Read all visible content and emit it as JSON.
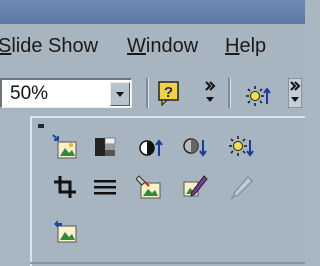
{
  "menu": {
    "items": [
      {
        "label": "Slide Show",
        "underline": "S"
      },
      {
        "label": "Window",
        "underline": "W"
      },
      {
        "label": "Help",
        "underline": "H"
      }
    ]
  },
  "toolbar": {
    "zoom_value": "50%"
  },
  "picture_toolbar": {
    "buttons": [
      "insert-picture-icon",
      "color-icon",
      "more-contrast-icon",
      "less-contrast-icon",
      "less-brightness-icon",
      "crop-icon",
      "line-style-icon",
      "format-picture-icon",
      "set-transparent-color-icon",
      "recolor-picture-icon",
      "reset-picture-icon"
    ]
  },
  "colors": {
    "background": "#a7b5c1",
    "title_strip": "#5a79a6"
  }
}
